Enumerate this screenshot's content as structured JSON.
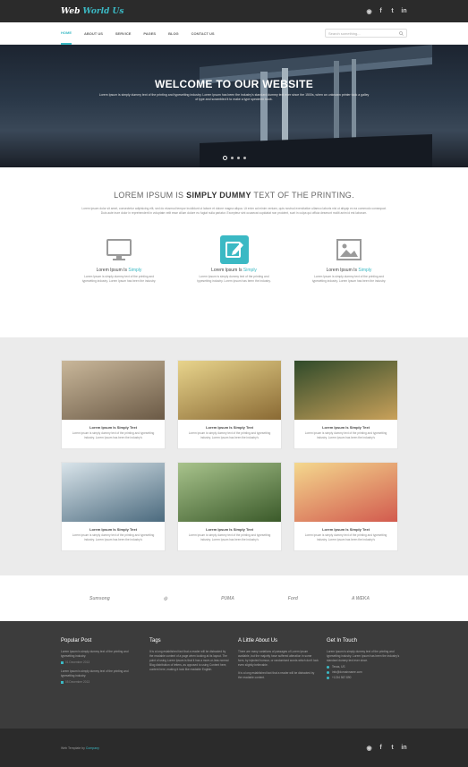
{
  "brand": {
    "logo_part1": "Web",
    "logo_part2": "World",
    "logo_part3": "Us"
  },
  "social": [
    "rss",
    "f",
    "t",
    "in"
  ],
  "nav": {
    "items": [
      "HOME",
      "ABOUT US",
      "SERVICE",
      "PAGES",
      "BLOG",
      "CONTACT US"
    ],
    "search_placeholder": "Search something..."
  },
  "hero": {
    "title": "WELCOME TO OUR WEBSITE",
    "text": "Lorem Ipsum is simply dummy text of the printing and typesetting industry. Lorem Ipsum has been the industry's standard dummy text ever since the 1500s, when an unknown printer took a galley of type and scrambled it to make a type specimen book."
  },
  "intro": {
    "heading_pre": "LOREM IPSUM IS",
    "heading_bold": "SIMPLY DUMMY",
    "heading_post": "TEXT OF THE PRINTING.",
    "lead": "Lorem ipsum dolor sit amet, consectetur adipisicing elit, sed do eiusmod tempor incididunt ut labore et dolore magna aliqua. Ut enim ad minim veniam, quis nostrud exercitation ullamco laboris nisi ut aliquip ex ea commodo consequat. Duis aute irure dolor in reprehenderit in voluptate velit esse cillum dolore eu fugiat nulla pariatur. Excepteur sint occaecat cupidatat non proident, sunt in culpa qui officia deserunt mollit anim id est laborum."
  },
  "features": [
    {
      "icon": "monitor-icon",
      "title": "Lorem Ipsum Is",
      "sub": "Simply",
      "desc": "Lorem Ipsum is simply dummy text of the printing and typesetting industry. Lorem Ipsum has been the industry."
    },
    {
      "icon": "edit-icon",
      "title": "Lorem Ipsum Is",
      "sub": "Simply",
      "desc": "Lorem Ipsum is simply dummy text of the printing and typesetting industry. Lorem Ipsum has been the industry."
    },
    {
      "icon": "image-icon",
      "title": "Lorem Ipsum Is",
      "sub": "Simply",
      "desc": "Lorem Ipsum is simply dummy text of the printing and typesetting industry. Lorem Ipsum has been the industry."
    }
  ],
  "cards": [
    {
      "title": "Lorem Ipsum Is Simply Text",
      "desc": "Lorem ipsum is simply dummy text of the printing and typesetting industry. Lorem Ipsum has been the industry's",
      "colors": [
        "#c9b79a",
        "#6b5a46"
      ]
    },
    {
      "title": "Lorem Ipsum Is Simply Text",
      "desc": "Lorem ipsum is simply dummy text of the printing and typesetting industry. Lorem Ipsum has been the industry's",
      "colors": [
        "#e8d48c",
        "#8a6a34"
      ]
    },
    {
      "title": "Lorem Ipsum Is Simply Text",
      "desc": "Lorem ipsum is simply dummy text of the printing and typesetting industry. Lorem Ipsum has been the industry's",
      "colors": [
        "#2f4a2a",
        "#c9a15a"
      ]
    },
    {
      "title": "Lorem Ipsum Is Simply Text",
      "desc": "Lorem ipsum is simply dummy text of the printing and typesetting industry. Lorem Ipsum has been the industry's",
      "colors": [
        "#d9e4ea",
        "#4b6a7e"
      ]
    },
    {
      "title": "Lorem Ipsum Is Simply Text",
      "desc": "Lorem ipsum is simply dummy text of the printing and typesetting industry. Lorem Ipsum has been the industry's",
      "colors": [
        "#a8c38c",
        "#3b5a2a"
      ]
    },
    {
      "title": "Lorem Ipsum Is Simply Text",
      "desc": "Lorem ipsum is simply dummy text of the printing and typesetting industry. Lorem Ipsum has been the industry's",
      "colors": [
        "#f4d88e",
        "#d25a4e"
      ]
    }
  ],
  "clients": [
    "Sumsong",
    "◎",
    "PUMA",
    "Ford",
    "A WEKA"
  ],
  "footer": {
    "popular": {
      "title": "Popular Post",
      "p1": "Lorem Ipsum is simply dummy text of the printing and typesetting industry.",
      "d1": "01 December 2013",
      "p2": "Lorem Ipsum is simply dummy text of the printing and typesetting industry.",
      "d2": "05 December 2013"
    },
    "tags": {
      "title": "Tags",
      "text": "It is a long established fact that a reader will be distracted by the readable content of a page when looking at its layout. The point of using Lorem Ipsum is that it has a more-or-less normal Blog distribution of letters, as opposed to using Content here, content here, making it look like readable English."
    },
    "about": {
      "title": "A Little About Us",
      "p1": "There are many variations of passages of Lorem Ipsum available, but the majority have suffered alteration in some form, by injected humour, or randomised words which don't look even slightly believable.",
      "p2": "It is a long established fact that a reader will be distracted by the readable content."
    },
    "contact": {
      "title": "Get In Touch",
      "text": "Lorem Ipsum is simply dummy text of the printing and typesetting industry. Lorem Ipsum has been the industry's standard dummy text ever since.",
      "address": "Texas, US",
      "email": "info@domainname.com",
      "phone": "+1234 567 890"
    }
  },
  "bottom": {
    "copy_pre": "Web Template by",
    "copy_link": "Company"
  },
  "colors": {
    "accent": "#3bb9c4",
    "dark": "#2b2b2b",
    "footer": "#3c3c3c"
  }
}
